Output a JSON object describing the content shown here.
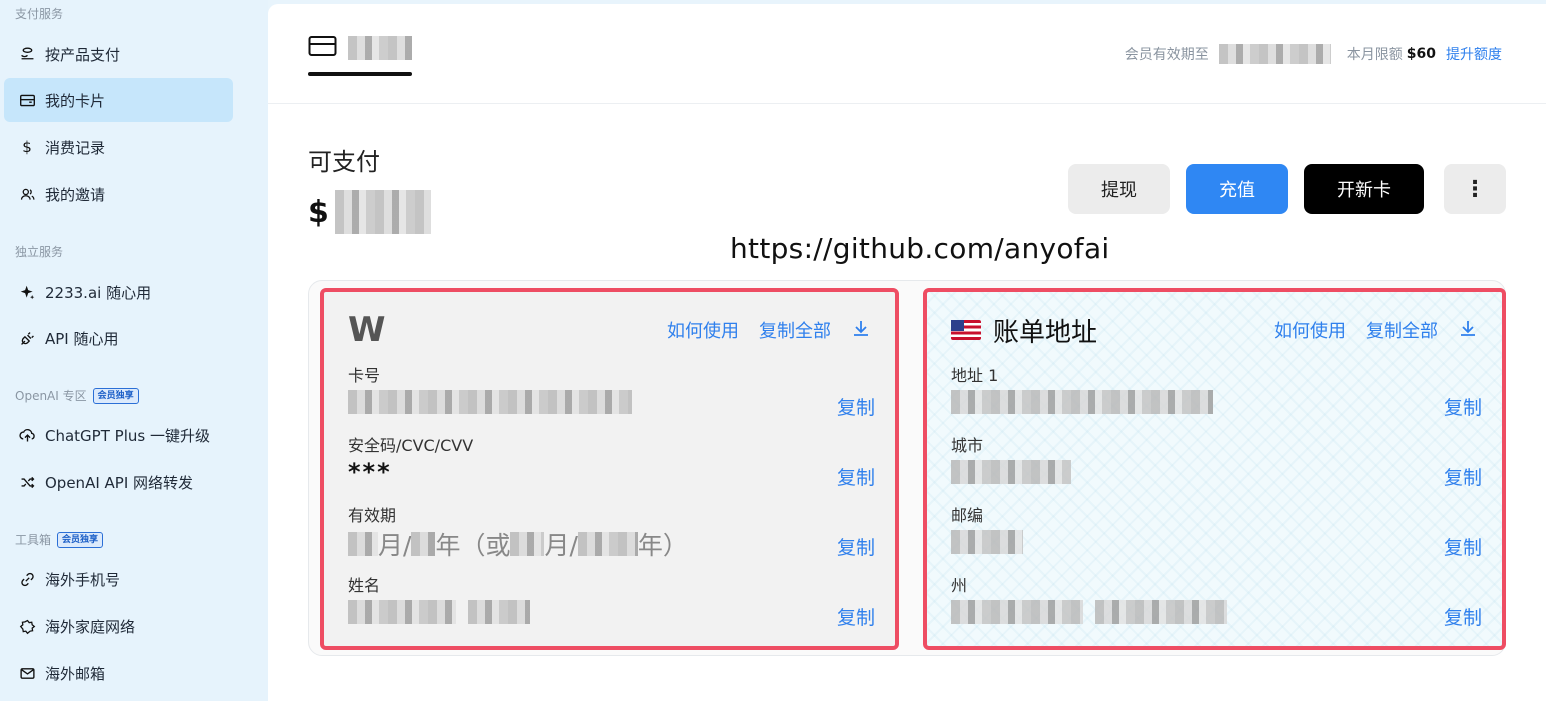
{
  "sidebar": {
    "sections": [
      {
        "title": "支付服务"
      },
      {
        "title": "独立服务"
      },
      {
        "title": "OpenAI 专区",
        "badge": "会员独享"
      },
      {
        "title": "工具箱",
        "badge": "会员独享"
      }
    ],
    "items": [
      {
        "label": "按产品支付",
        "icon": "pay-icon"
      },
      {
        "label": "我的卡片",
        "icon": "card-icon",
        "active": true
      },
      {
        "label": "消费记录",
        "icon": "dollar-icon"
      },
      {
        "label": "我的邀请",
        "icon": "people-icon"
      },
      {
        "label": "2233.ai 随心用",
        "icon": "sparkle-icon"
      },
      {
        "label": "API 随心用",
        "icon": "plug-icon"
      },
      {
        "label": "ChatGPT Plus 一键升级",
        "icon": "upload-icon"
      },
      {
        "label": "OpenAI API 网络转发",
        "icon": "shuffle-icon"
      },
      {
        "label": "海外手机号",
        "icon": "phone-icon"
      },
      {
        "label": "海外家庭网络",
        "icon": "network-icon"
      },
      {
        "label": "海外邮箱",
        "icon": "mail-icon"
      }
    ]
  },
  "header": {
    "member_label": "会员有效期至",
    "limit_label": "本月限额",
    "limit_amount": "$60",
    "raise_link": "提升额度"
  },
  "balance": {
    "label": "可支付",
    "currency": "$"
  },
  "actions": {
    "withdraw": "提现",
    "recharge": "充值",
    "new_card": "开新卡",
    "more": "⋮"
  },
  "watermark": "https://github.com/anyofai",
  "card": {
    "logo": "W",
    "how_to_use": "如何使用",
    "copy_all": "复制全部",
    "download": "⤓",
    "fields": [
      {
        "label": "卡号"
      },
      {
        "label": "安全码/CVC/CVV",
        "value": "***"
      },
      {
        "label": "有效期",
        "month": "月/",
        "year": "年",
        "alt_open": "（或",
        "alt_month": "月/",
        "alt_year": "年）"
      },
      {
        "label": "姓名"
      }
    ],
    "copy": "复制"
  },
  "billing": {
    "title": "账单地址",
    "how_to_use": "如何使用",
    "copy_all": "复制全部",
    "download": "⤓",
    "fields": [
      {
        "label": "地址 1"
      },
      {
        "label": "城市"
      },
      {
        "label": "邮编"
      },
      {
        "label": "州"
      }
    ],
    "copy": "复制"
  },
  "colors": {
    "accent": "#2f80ed",
    "highlight_border": "#ee4d63",
    "sidebar_bg": "#e6f3fc",
    "active_item": "#c6e6fb"
  }
}
